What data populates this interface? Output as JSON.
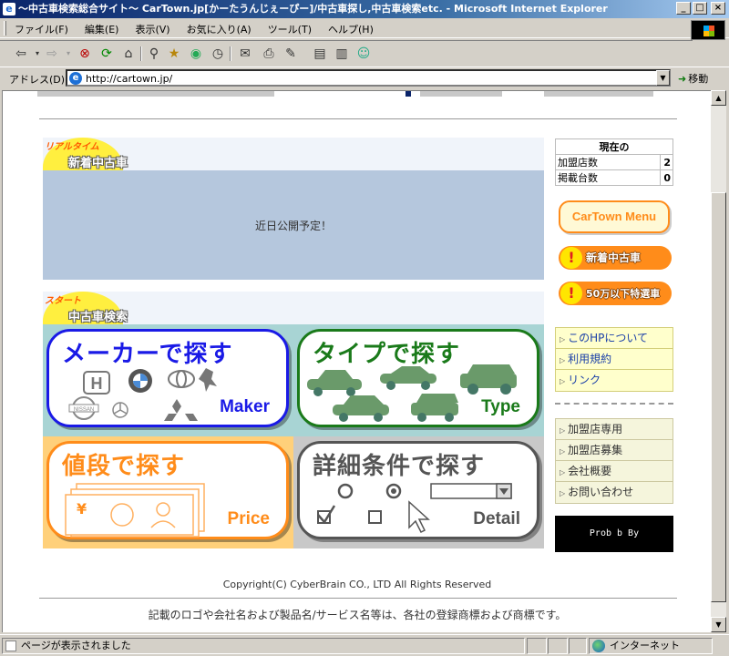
{
  "window": {
    "title": "～中古車検索総合サイト～ CarTown.jp[かーたうんじぇーぴー]/中古車探し,中古車検索etc. - Microsoft Internet Explorer",
    "app_icon": "ie-page-icon",
    "controls": [
      "minimize",
      "maximize",
      "close"
    ]
  },
  "menu": [
    "ファイル(F)",
    "編集(E)",
    "表示(V)",
    "お気に入り(A)",
    "ツール(T)",
    "ヘルプ(H)"
  ],
  "toolbar": {
    "icons": [
      "back-icon",
      "forward-icon",
      "stop-icon",
      "refresh-icon",
      "home-icon",
      "search-icon",
      "favorites-icon",
      "media-icon",
      "history-icon",
      "mail-icon",
      "print-icon",
      "edit-icon",
      "discuss-icon",
      "messenger-icon"
    ]
  },
  "address": {
    "label": "アドレス(D)",
    "url": "http://cartown.jp/",
    "go_label": "移動"
  },
  "page": {
    "newcar_section": {
      "tag": "リアルタイム",
      "title": "新着中古車",
      "message": "近日公開予定！"
    },
    "search_section": {
      "tag": "スタート",
      "title": "中古車検索",
      "tiles": [
        {
          "title": "メーカーで探す",
          "en": "Maker",
          "color": "#1a1ae6",
          "bg": "#a8d4d4"
        },
        {
          "title": "タイプで探す",
          "en": "Type",
          "color": "#1a7a1a",
          "bg": "#a8d4d4"
        },
        {
          "title": "値段で探す",
          "en": "Price",
          "color": "#ff8c1a",
          "bg": "#ffd07a"
        },
        {
          "title": "詳細条件で探す",
          "en": "Detail",
          "color": "#555555",
          "bg": "#c8c8c8"
        }
      ],
      "maker_logos": [
        "honda-logo",
        "bmw-logo",
        "toyota-logo",
        "peugeot-logo",
        "nissan-logo",
        "mercedes-logo",
        "mitsubishi-logo"
      ],
      "price_symbol": "¥"
    },
    "stats": {
      "header": "現在の",
      "rows": [
        {
          "label": "加盟店数",
          "value": "2"
        },
        {
          "label": "掲載台数",
          "value": "0"
        }
      ]
    },
    "side_buttons": {
      "menu": "CarTown Menu",
      "new_cars": "新着中古車",
      "cheap_cars": "50万以下特選車"
    },
    "links_group1": [
      "このHPについて",
      "利用規約",
      "リンク"
    ],
    "links_group2": [
      "加盟店専用",
      "加盟店募集",
      "会社概要",
      "お問い合わせ"
    ],
    "banner": "Prob  b By",
    "copyright": "Copyright(C) CyberBrain CO., LTD All Rights Reserved",
    "disclaimer": "記載のロゴや会社名および製品名/サービス名等は、各社の登録商標および商標です。"
  },
  "status": {
    "text": "ページが表示されました",
    "zone": "インターネット"
  }
}
